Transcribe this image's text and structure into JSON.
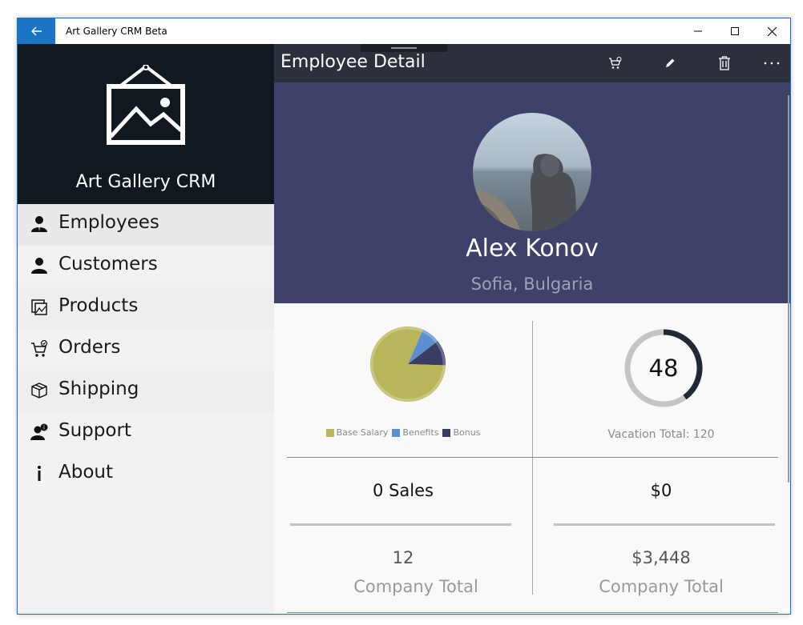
{
  "window": {
    "title": "Art Gallery CRM Beta"
  },
  "sidebar": {
    "brand": "Art Gallery CRM",
    "items": [
      {
        "label": "Employees",
        "icon": "employees-icon"
      },
      {
        "label": "Customers",
        "icon": "customers-icon"
      },
      {
        "label": "Products",
        "icon": "products-icon"
      },
      {
        "label": "Orders",
        "icon": "orders-icon"
      },
      {
        "label": "Shipping",
        "icon": "shipping-icon"
      },
      {
        "label": "Support",
        "icon": "support-icon"
      },
      {
        "label": "About",
        "icon": "info-icon"
      }
    ]
  },
  "header": {
    "title": "Employee Detail"
  },
  "employee": {
    "name": "Alex Konov",
    "location": "Sofia, Bulgaria"
  },
  "compensation": {
    "legend": [
      "Base Salary",
      "Benefits",
      "Bonus"
    ],
    "colors": [
      "#b8b55a",
      "#5b8fd0",
      "#3a3d63"
    ]
  },
  "chart_data": {
    "type": "pie",
    "categories": [
      "Base Salary",
      "Benefits",
      "Bonus"
    ],
    "values": [
      81,
      8,
      11
    ]
  },
  "vacation": {
    "remaining": "48",
    "total_label": "Vacation Total: 120",
    "total": 120,
    "used_fraction": 0.4
  },
  "stats": {
    "sales": "0 Sales",
    "amount": "$0",
    "sales_company_total": "12",
    "amount_company_total": "$3,448",
    "company_total_label": "Company Total"
  },
  "colors": {
    "accent": "#1b75c6",
    "hero": "#3e4169",
    "brand_bg": "#101820",
    "cmdbar": "#2b303a"
  }
}
